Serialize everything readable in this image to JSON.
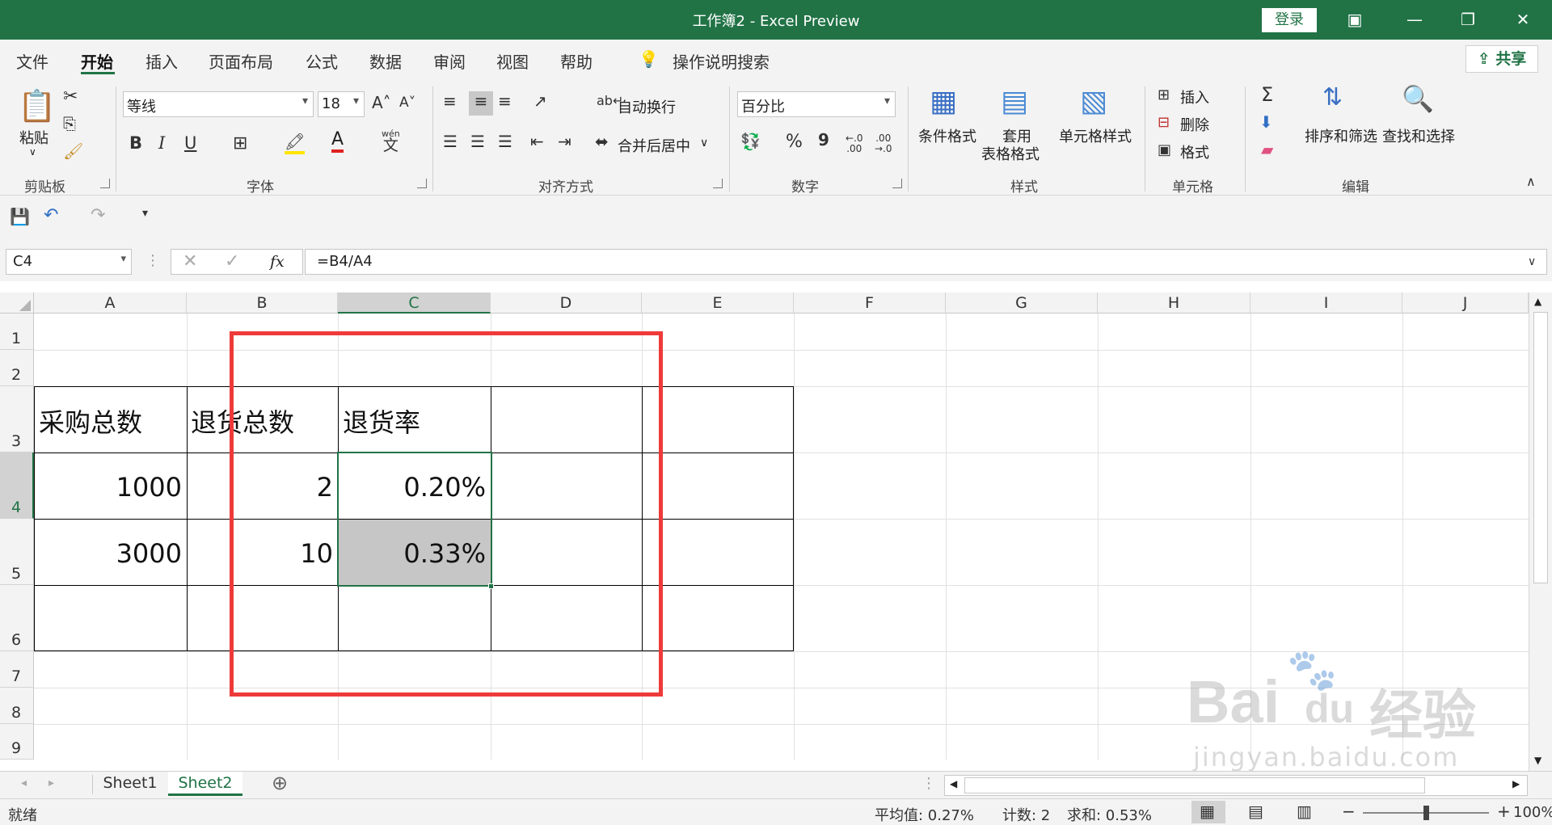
{
  "window": {
    "title": "工作簿2 - Excel Preview",
    "login_label": "登录",
    "theme_color": "#217346"
  },
  "tabs": {
    "items": [
      "文件",
      "开始",
      "插入",
      "页面布局",
      "公式",
      "数据",
      "审阅",
      "视图",
      "帮助"
    ],
    "active": "开始",
    "tell_me": "操作说明搜索",
    "share": "共享"
  },
  "ribbon": {
    "clipboard": {
      "paste": "粘贴",
      "group": "剪贴板"
    },
    "font": {
      "name": "等线",
      "size": "18",
      "group": "字体",
      "bold": "B",
      "italic": "I",
      "underline": "U",
      "wen": "wén",
      "wen_char": "文"
    },
    "alignment": {
      "wrap": "自动换行",
      "merge": "合并后居中",
      "group": "对齐方式"
    },
    "number": {
      "format": "百分比",
      "percent": "%",
      "comma": "9",
      "group": "数字"
    },
    "styles": {
      "conditional": "条件格式",
      "table_line1": "套用",
      "table_line2": "表格格式",
      "cell_styles": "单元格样式",
      "group": "样式"
    },
    "cells": {
      "insert": "插入",
      "delete": "删除",
      "format": "格式",
      "group": "单元格"
    },
    "editing": {
      "sort": "排序和筛选",
      "find": "查找和选择",
      "group": "编辑"
    }
  },
  "formula_bar": {
    "name_box": "C4",
    "formula": "=B4/A4",
    "fx": "fx"
  },
  "sheet": {
    "columns": [
      "A",
      "B",
      "C",
      "D",
      "E",
      "F",
      "G",
      "H",
      "I",
      "J"
    ],
    "selected_column": "C",
    "rows": [
      "1",
      "2",
      "3",
      "4",
      "5",
      "6",
      "7",
      "8",
      "9"
    ],
    "selected_row": "4",
    "cells": {
      "A3": "采购总数",
      "B3": "退货总数",
      "C3": "退货率",
      "A4": "1000",
      "B4": "2",
      "C4": "0.20%",
      "A5": "3000",
      "B5": "10",
      "C5": "0.33%"
    },
    "annotation_color": "#ef3a3a"
  },
  "sheet_tabs": {
    "items": [
      "Sheet1",
      "Sheet2"
    ],
    "active": "Sheet2"
  },
  "status": {
    "ready": "就绪",
    "average": "平均值: 0.27%",
    "count": "计数: 2",
    "sum": "求和: 0.53%",
    "zoom": "100%"
  },
  "watermark": {
    "line1": "Bai",
    "line2": "du",
    "line3": "经验",
    "url": "jingyan.baidu.com"
  }
}
